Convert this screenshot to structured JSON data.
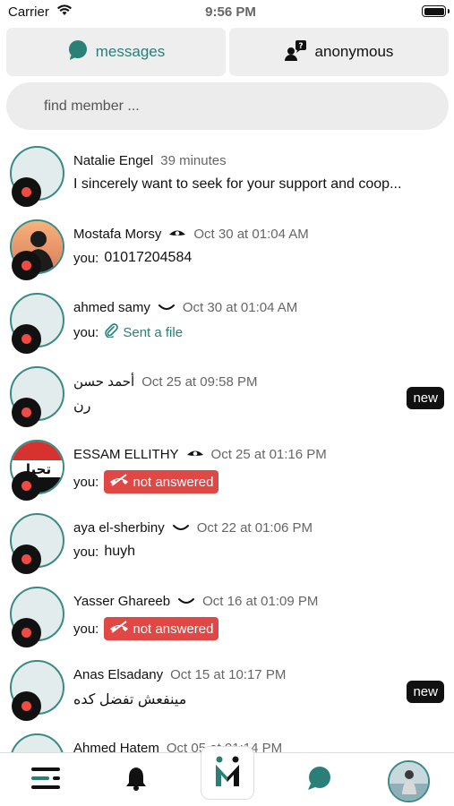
{
  "status_bar": {
    "carrier": "Carrier",
    "time": "9:56 PM"
  },
  "tabs": [
    {
      "label": "messages",
      "icon": "chat-bubble-icon",
      "active": true
    },
    {
      "label": "anonymous",
      "icon": "anonymous-user-icon",
      "active": false
    }
  ],
  "search": {
    "placeholder": "find member ..."
  },
  "conversations": [
    {
      "name": "Natalie Engel",
      "seen": "",
      "time": "39 minutes",
      "prefix": "",
      "message": "I sincerely want to seek for your support and coop...",
      "type": "text",
      "new": ""
    },
    {
      "name": "Mostafa Morsy",
      "seen": "eye",
      "time": "Oct 30 at 01:04 AM",
      "prefix": "you:",
      "message": "01017204584",
      "type": "text",
      "new": ""
    },
    {
      "name": "ahmed samy",
      "seen": "closed-eye",
      "time": "Oct 30 at 01:04 AM",
      "prefix": "you:",
      "message": "Sent a file",
      "type": "file",
      "new": ""
    },
    {
      "name": "أحمد حسن",
      "seen": "",
      "time": "Oct 25 at 09:58 PM",
      "prefix": "",
      "message": "رن",
      "type": "text",
      "new": "new"
    },
    {
      "name": "ESSAM ELLITHY",
      "seen": "eye",
      "time": "Oct 25 at 01:16 PM",
      "prefix": "you:",
      "message": "not answered",
      "type": "call",
      "new": ""
    },
    {
      "name": "aya el-sherbiny",
      "seen": "closed-eye",
      "time": "Oct 22 at 01:06 PM",
      "prefix": "you:",
      "message": "huyh",
      "type": "text",
      "new": ""
    },
    {
      "name": "Yasser Ghareeb",
      "seen": "closed-eye",
      "time": "Oct 16 at 01:09 PM",
      "prefix": "you:",
      "message": "not answered",
      "type": "call",
      "new": ""
    },
    {
      "name": "Anas Elsadany",
      "seen": "",
      "time": "Oct 15 at 10:17 PM",
      "prefix": "",
      "message": "مينفعش تفضل كده",
      "type": "text",
      "new": "new"
    },
    {
      "name": "Ahmed Hatem",
      "seen": "",
      "time": "Oct 05 at 01:14 PM",
      "prefix": "",
      "message": "",
      "type": "text",
      "new": ""
    }
  ],
  "bottom_nav": {
    "items": [
      "menu-icon",
      "bell-icon",
      "app-logo",
      "chat-icon",
      "profile-avatar"
    ]
  },
  "colors": {
    "accent": "#2a7f78",
    "danger": "#e04845",
    "record_dot": "#ef4b43"
  }
}
